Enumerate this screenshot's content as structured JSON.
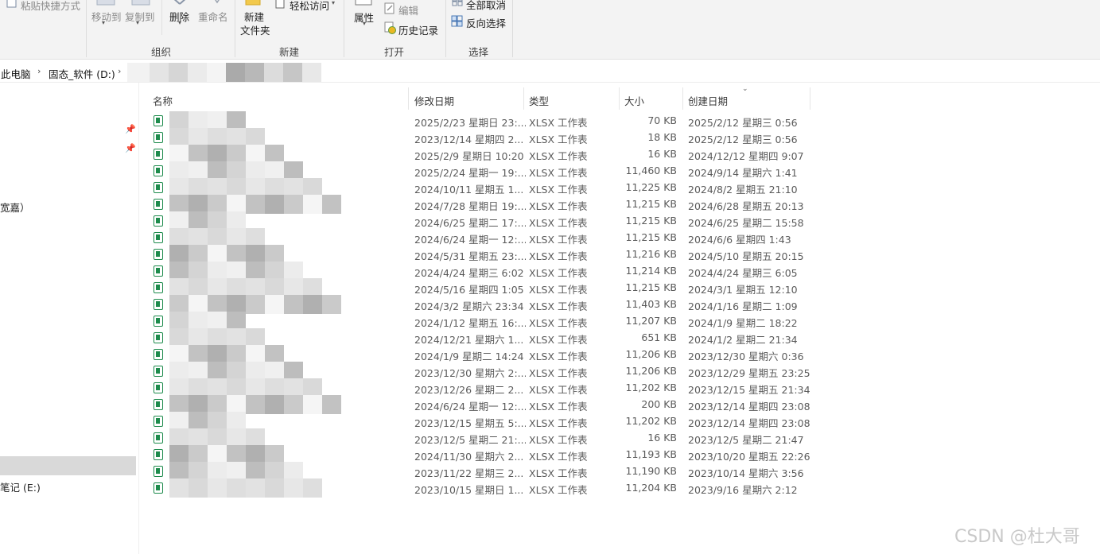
{
  "ribbon": {
    "paste_shortcut": "粘贴快捷方式",
    "move_to": "移动到",
    "copy_to": "复制到",
    "delete": "删除",
    "rename": "重命名",
    "new_folder_line1": "新建",
    "new_folder_line2": "文件夹",
    "easy_access": "轻松访问",
    "properties": "属性",
    "edit": "编辑",
    "history": "历史记录",
    "select_none": "全部取消",
    "invert_selection": "反向选择",
    "groups": {
      "organize": "组织",
      "new": "新建",
      "open": "打开",
      "select": "选择"
    }
  },
  "address": {
    "this_pc": "此电脑",
    "drive": "固态_软件 (D:)"
  },
  "nav": {
    "partial_item": "宽嘉）",
    "drive_e": "笔记 (E:)"
  },
  "columns": {
    "name": "名称",
    "modified": "修改日期",
    "type": "类型",
    "size": "大小",
    "created": "创建日期"
  },
  "files": [
    {
      "modified": "2025/2/23 星期日 23:...",
      "type": "XLSX 工作表",
      "size": "70 KB",
      "created": "2025/2/12 星期三 0:56"
    },
    {
      "modified": "2023/12/14 星期四 2...",
      "type": "XLSX 工作表",
      "size": "18 KB",
      "created": "2025/2/12 星期三 0:56"
    },
    {
      "modified": "2025/2/9 星期日 10:20",
      "type": "XLSX 工作表",
      "size": "16 KB",
      "created": "2024/12/12 星期四 9:07"
    },
    {
      "modified": "2025/2/24 星期一 19:...",
      "type": "XLSX 工作表",
      "size": "11,460 KB",
      "created": "2024/9/14 星期六 1:41"
    },
    {
      "modified": "2024/10/11 星期五 1...",
      "type": "XLSX 工作表",
      "size": "11,225 KB",
      "created": "2024/8/2 星期五 21:10"
    },
    {
      "modified": "2024/7/28 星期日 19:...",
      "type": "XLSX 工作表",
      "size": "11,215 KB",
      "created": "2024/6/28 星期五 20:13"
    },
    {
      "modified": "2024/6/25 星期二 17:...",
      "type": "XLSX 工作表",
      "size": "11,215 KB",
      "created": "2024/6/25 星期二 15:58"
    },
    {
      "modified": "2024/6/24 星期一 12:...",
      "type": "XLSX 工作表",
      "size": "11,215 KB",
      "created": "2024/6/6 星期四 1:43"
    },
    {
      "modified": "2024/5/31 星期五 23:...",
      "type": "XLSX 工作表",
      "size": "11,216 KB",
      "created": "2024/5/10 星期五 20:15"
    },
    {
      "modified": "2024/4/24 星期三 6:02",
      "type": "XLSX 工作表",
      "size": "11,214 KB",
      "created": "2024/4/24 星期三 6:05"
    },
    {
      "modified": "2024/5/16 星期四 1:05",
      "type": "XLSX 工作表",
      "size": "11,215 KB",
      "created": "2024/3/1 星期五 12:10"
    },
    {
      "modified": "2024/3/2 星期六 23:34",
      "type": "XLSX 工作表",
      "size": "11,403 KB",
      "created": "2024/1/16 星期二 1:09"
    },
    {
      "modified": "2024/1/12 星期五 16:...",
      "type": "XLSX 工作表",
      "size": "11,207 KB",
      "created": "2024/1/9 星期二 18:22"
    },
    {
      "modified": "2024/12/21 星期六 1...",
      "type": "XLSX 工作表",
      "size": "651 KB",
      "created": "2024/1/2 星期二 21:34"
    },
    {
      "modified": "2024/1/9 星期二 14:24",
      "type": "XLSX 工作表",
      "size": "11,206 KB",
      "created": "2023/12/30 星期六 0:36"
    },
    {
      "modified": "2023/12/30 星期六 2:...",
      "type": "XLSX 工作表",
      "size": "11,206 KB",
      "created": "2023/12/29 星期五 23:25"
    },
    {
      "modified": "2023/12/26 星期二 2...",
      "type": "XLSX 工作表",
      "size": "11,202 KB",
      "created": "2023/12/15 星期五 21:34"
    },
    {
      "modified": "2024/6/24 星期一 12:...",
      "type": "XLSX 工作表",
      "size": "200 KB",
      "created": "2023/12/14 星期四 23:08"
    },
    {
      "modified": "2023/12/15 星期五 5:...",
      "type": "XLSX 工作表",
      "size": "11,202 KB",
      "created": "2023/12/14 星期四 23:08"
    },
    {
      "modified": "2023/12/5 星期二 21:...",
      "type": "XLSX 工作表",
      "size": "16 KB",
      "created": "2023/12/5 星期二 21:47"
    },
    {
      "modified": "2024/11/30 星期六 2...",
      "type": "XLSX 工作表",
      "size": "11,193 KB",
      "created": "2023/10/20 星期五 22:26"
    },
    {
      "modified": "2023/11/22 星期三 2...",
      "type": "XLSX 工作表",
      "size": "11,190 KB",
      "created": "2023/10/14 星期六 3:56"
    },
    {
      "modified": "2023/10/15 星期日 1...",
      "type": "XLSX 工作表",
      "size": "11,204 KB",
      "created": "2023/9/16 星期六 2:12"
    }
  ],
  "watermark": "CSDN @杜大哥",
  "colors": {
    "ribbon_bg": "#f3f3f3",
    "selected_nav": "#d9d9d9",
    "excel_green": "#1d8b4c"
  }
}
